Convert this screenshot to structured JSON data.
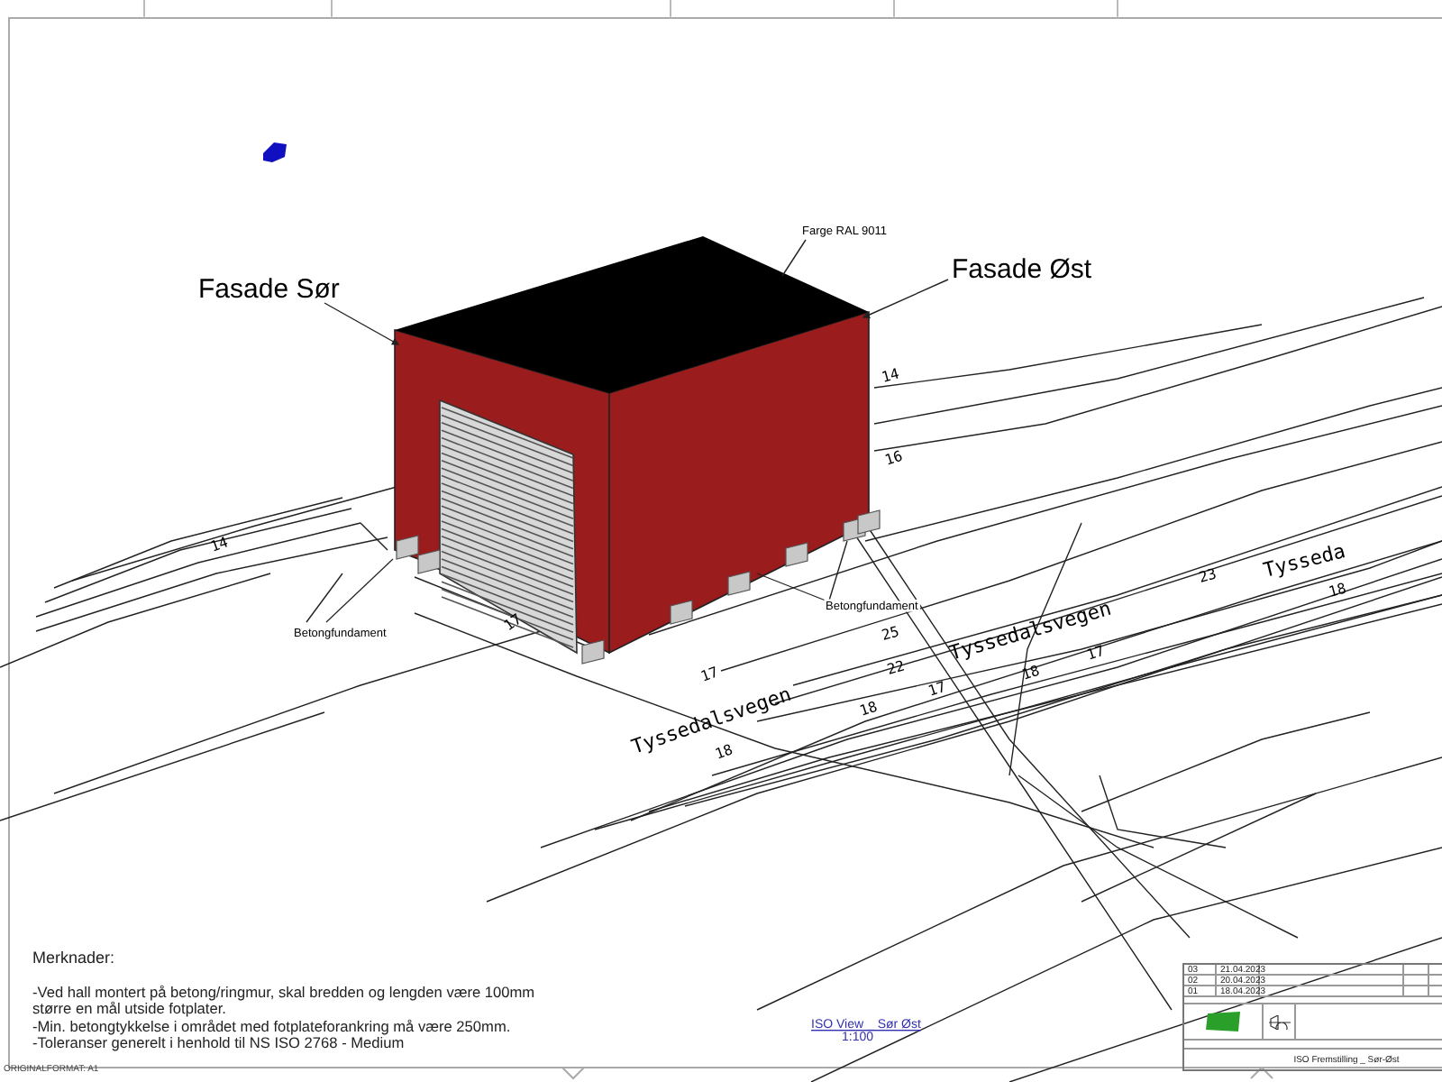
{
  "drawing": {
    "facade_south": "Fasade Sør",
    "facade_east": "Fasade Øst",
    "color_note": "Farge RAL 9011",
    "foundation_labels": [
      "Betongfundament",
      "Betongfundament"
    ],
    "map_labels": [
      "Tyssedalsvegen",
      "Tyssedalsvegen",
      "Tysseda",
      "14",
      "14",
      "16",
      "17",
      "17",
      "17",
      "18",
      "18",
      "22",
      "25",
      "23",
      "18",
      "17",
      "18"
    ],
    "view_title": "ISO View _ Sør Øst",
    "view_scale": "1:100"
  },
  "notes": {
    "heading": "Merknader:",
    "lines": [
      "-Ved hall montert på betong/ringmur, skal bredden og lengden være 100mm\nstørre en mål utside fotplater.",
      "-Min. betongtykkelse i området med fotplateforankring må være 250mm.",
      "-Toleranser generelt i henhold til NS ISO 2768 - Medium"
    ]
  },
  "title_block": {
    "revisions": [
      {
        "rev": "03",
        "date": "21.04.2023"
      },
      {
        "rev": "02",
        "date": "20.04.2023"
      },
      {
        "rev": "01",
        "date": "18.04.2023"
      }
    ],
    "drawing_title": "ISO Fremstilling _ Sør-Øst"
  },
  "sheet_format": "ORIGINALFORMAT: A1"
}
